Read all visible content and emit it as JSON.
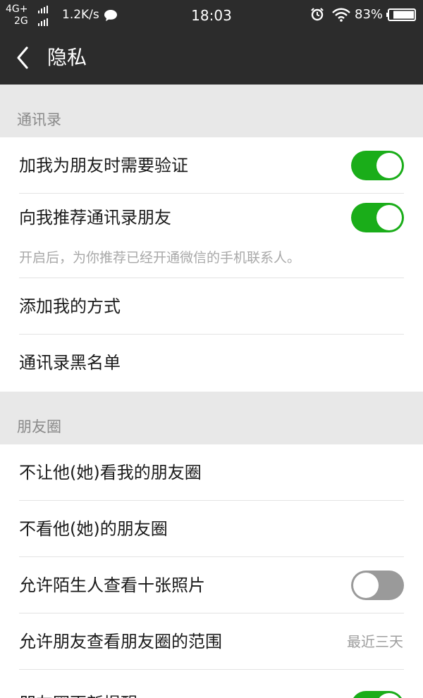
{
  "status_bar": {
    "net1": "4G+",
    "net2": "2G",
    "speed": "1.2K/s",
    "time": "18:03",
    "battery": "83%",
    "icons": [
      "chat-bubble-icon",
      "alarm-icon",
      "wifi-icon",
      "battery-icon"
    ]
  },
  "nav": {
    "title": "隐私",
    "back_icon": "chevron-left-icon"
  },
  "sections": [
    {
      "header": "通讯录",
      "rows": [
        {
          "label": "加我为朋友时需要验证",
          "toggle": true
        },
        {
          "label": "向我推荐通讯录朋友",
          "toggle": true
        },
        {
          "label": "添加我的方式"
        },
        {
          "label": "通讯录黑名单"
        }
      ],
      "hint": "开启后，为你推荐已经开通微信的手机联系人。"
    },
    {
      "header": "朋友圈",
      "rows": [
        {
          "label": "不让他(她)看我的朋友圈"
        },
        {
          "label": "不看他(她)的朋友圈"
        },
        {
          "label": "允许陌生人查看十张照片",
          "toggle": false
        },
        {
          "label": "允许朋友查看朋友圈的范围",
          "value": "最近三天"
        },
        {
          "label": "朋友圈更新提醒",
          "toggle": true
        }
      ]
    }
  ],
  "colors": {
    "header_bg": "#2c2c2c",
    "toggle_on": "#1aad19",
    "toggle_off": "#9a9a9a",
    "page_bg": "#e8e8e8"
  }
}
